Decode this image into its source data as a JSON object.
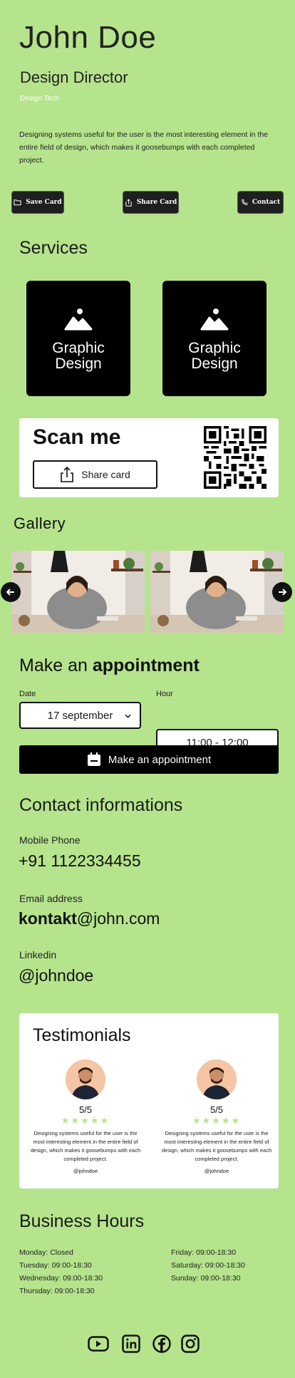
{
  "profile": {
    "name": "John Doe",
    "title": "Design Director",
    "company": "Design Tech",
    "bio": "Designing systems useful for the user is the most interesting element in the entire field of design, which makes it goosebumps with each completed project."
  },
  "actions": {
    "save_label": "Save Card",
    "share_label": "Share Card",
    "contact_label": "Contact"
  },
  "services": {
    "title": "Services",
    "items": [
      {
        "label_line1": "Graphic",
        "label_line2": "Design",
        "icon": "image-icon"
      },
      {
        "label_line1": "Graphic",
        "label_line2": "Design",
        "icon": "image-icon"
      }
    ]
  },
  "scan": {
    "title": "Scan me",
    "share_button": "Share card"
  },
  "gallery": {
    "title": "Gallery"
  },
  "appointment": {
    "title_light": "Make an",
    "title_bold": "appointment",
    "date_label": "Date",
    "date_value": "17 september",
    "hour_label": "Hour",
    "hour_value": "11:00 - 12:00",
    "button_label": "Make an appointment"
  },
  "contact": {
    "title": "Contact informations",
    "phone_label": "Mobile Phone",
    "phone_value": "+91 1122334455",
    "email_label": "Email address",
    "email_bold": "kontakt",
    "email_rest": "@john.com",
    "linkedin_label": "Linkedin",
    "linkedin_value": "@johndoe"
  },
  "testimonials": {
    "title": "Testimonials",
    "items": [
      {
        "rating": "5/5",
        "stars": "★★★★★",
        "text": "Designing systems useful for the user is the most interesting element in the entire field of design, which makes it goosebumps with each completed project.",
        "handle": "@johndoe"
      },
      {
        "rating": "5/5",
        "stars": "★★★★★",
        "text": "Designing systems useful for the user is the most interesting element in the entire field of design, which makes it goosebumps with each completed project.",
        "handle": "@johndoe"
      }
    ]
  },
  "hours": {
    "title": "Business Hours",
    "left": [
      "Monday: Closed",
      "Tuesday: 09:00-18:30",
      "Wednesday: 09:00-18:30",
      "Thursday: 09:00-18:30"
    ],
    "right": [
      "Friday: 09:00-18:30",
      "Saturday: 09:00-18:30",
      "Sunday: 09:00-18:30"
    ]
  },
  "social": [
    "youtube-icon",
    "linkedin-icon",
    "facebook-icon",
    "instagram-icon"
  ],
  "colors": {
    "background": "#b5e48c",
    "dark": "#000000",
    "star": "#b5e48c"
  }
}
